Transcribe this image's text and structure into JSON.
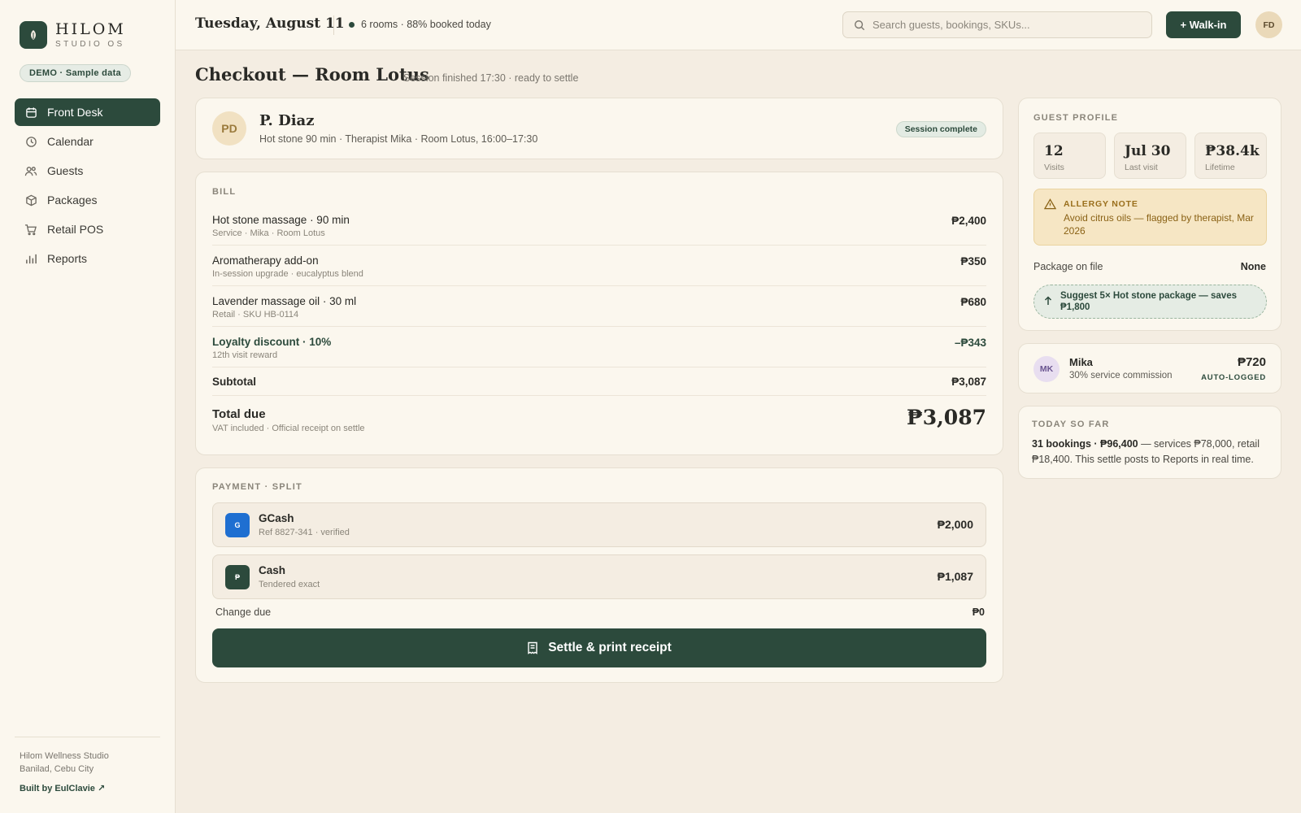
{
  "brand": {
    "name": "HILOM",
    "sub": "STUDIO OS",
    "demo": "DEMO · Sample data"
  },
  "nav": [
    {
      "label": "Front Desk",
      "icon": "calendar-icon",
      "active": true
    },
    {
      "label": "Calendar",
      "icon": "clock-icon"
    },
    {
      "label": "Guests",
      "icon": "users-icon"
    },
    {
      "label": "Packages",
      "icon": "box-icon"
    },
    {
      "label": "Retail POS",
      "icon": "cart-icon"
    },
    {
      "label": "Reports",
      "icon": "bar-chart-icon"
    }
  ],
  "footer": {
    "addr1": "Hilom Wellness Studio",
    "addr2": "Banilad, Cebu City",
    "built": "Built by EulClavie ↗"
  },
  "topbar": {
    "date": "Tuesday, August 11",
    "status": "6 rooms · 88% booked today",
    "search_placeholder": "Search guests, bookings, SKUs...",
    "walkin": "+ Walk-in",
    "user_initials": "FD"
  },
  "page": {
    "title": "Checkout — Room Lotus",
    "subtitle": "Session finished 17:30 · ready to settle"
  },
  "guest": {
    "initials": "PD",
    "name": "P. Diaz",
    "meta": "Hot stone 90 min · Therapist Mika · Room Lotus, 16:00–17:30",
    "badge": "Session complete"
  },
  "bill": {
    "label": "BILL",
    "items": [
      {
        "name": "Hot stone massage · 90 min",
        "sub": "Service · Mika · Room Lotus",
        "amount": "₱2,400"
      },
      {
        "name": "Aromatherapy add-on",
        "sub": "In-session upgrade · eucalyptus blend",
        "amount": "₱350"
      },
      {
        "name": "Lavender massage oil · 30 ml",
        "sub": "Retail · SKU HB-0114",
        "amount": "₱680"
      },
      {
        "name": "Loyalty discount · 10%",
        "sub": "12th visit reward",
        "amount": "–₱343"
      }
    ],
    "subtotal_label": "Subtotal",
    "subtotal": "₱3,087",
    "total_label": "Total due",
    "total_sub": "VAT included · Official receipt on settle",
    "total": "₱3,087"
  },
  "payment": {
    "label": "PAYMENT · SPLIT",
    "methods": [
      {
        "icon_letter": "G",
        "color": "#1f6fd1",
        "name": "GCash",
        "sub": "Ref 8827-341 · verified",
        "amount": "₱2,000"
      },
      {
        "icon_letter": "₱",
        "color": "#2c4a3c",
        "name": "Cash",
        "sub": "Tendered exact",
        "amount": "₱1,087"
      }
    ],
    "change_label": "Change due",
    "change": "₱0",
    "settle": "Settle & print receipt"
  },
  "profile": {
    "label": "GUEST PROFILE",
    "stats": [
      {
        "value": "12",
        "label": "Visits"
      },
      {
        "value": "Jul 30",
        "label": "Last visit"
      },
      {
        "value": "₱38.4k",
        "label": "Lifetime"
      }
    ],
    "allergy_title": "ALLERGY NOTE",
    "allergy_body": "Avoid citrus oils — flagged by therapist, Mar 2026",
    "package_label": "Package on file",
    "package_value": "None",
    "suggest": "Suggest 5× Hot stone package — saves ₱1,800"
  },
  "therapist": {
    "initials": "MK",
    "name": "Mika",
    "sub": "30% service commission",
    "amount": "₱720",
    "tag": "AUTO-LOGGED"
  },
  "today": {
    "label": "TODAY SO FAR",
    "bold": "31 bookings · ₱96,400",
    "rest": " — services ₱78,000, retail ₱18,400. This settle posts to Reports in real time."
  },
  "colors": {
    "accent": "#2c4a3c",
    "background": "#f4ede2",
    "allergy": "#f6e6c4",
    "gcash": "#1f6fd1"
  }
}
